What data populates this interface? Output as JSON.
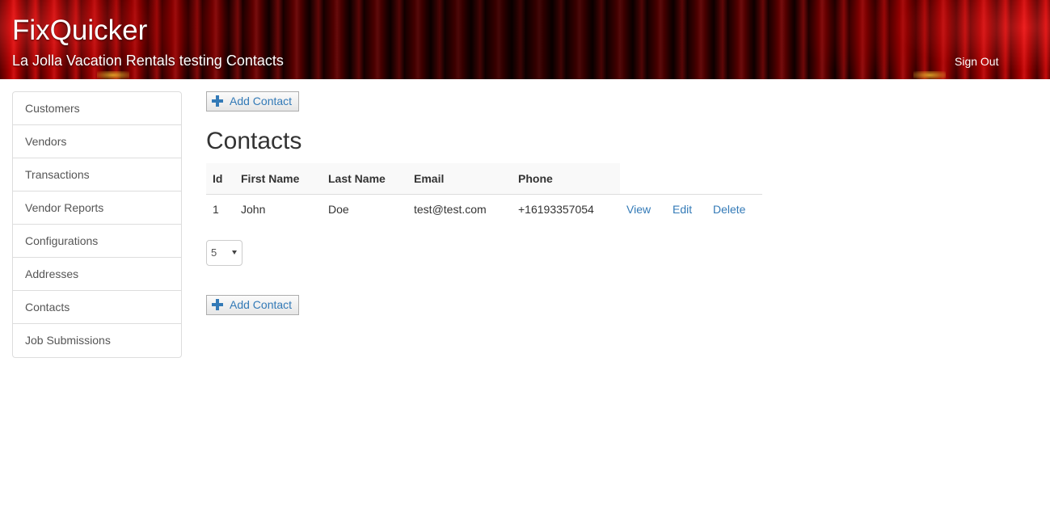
{
  "header": {
    "app_title": "FixQuicker",
    "subtitle": "La Jolla Vacation Rentals testing Contacts",
    "sign_out": "Sign Out"
  },
  "sidebar": {
    "items": [
      {
        "label": "Customers"
      },
      {
        "label": "Vendors"
      },
      {
        "label": "Transactions"
      },
      {
        "label": "Vendor Reports"
      },
      {
        "label": "Configurations"
      },
      {
        "label": "Addresses"
      },
      {
        "label": "Contacts"
      },
      {
        "label": "Job Submissions"
      }
    ]
  },
  "main": {
    "add_button_label": "Add Contact",
    "page_title": "Contacts",
    "table": {
      "columns": [
        "Id",
        "First Name",
        "Last Name",
        "Email",
        "Phone"
      ],
      "rows": [
        {
          "id": "1",
          "first_name": "John",
          "last_name": "Doe",
          "email": "test@test.com",
          "phone": "+16193357054",
          "view": "View",
          "edit": "Edit",
          "delete": "Delete"
        }
      ]
    },
    "page_size": {
      "selected": "5"
    }
  },
  "colors": {
    "link": "#337ab7",
    "banner_red": "#b30000",
    "border": "#dddddd"
  },
  "icons": {
    "add": "plus-icon",
    "select": "caret-down-icon"
  }
}
